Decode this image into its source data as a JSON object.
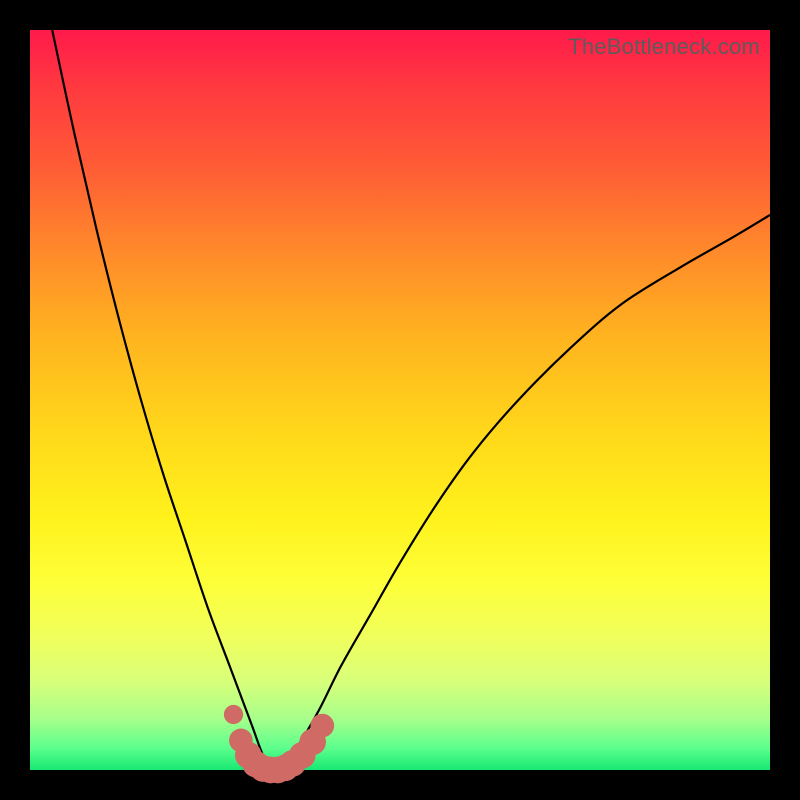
{
  "watermark": "TheBottleneck.com",
  "chart_data": {
    "type": "line",
    "title": "",
    "xlabel": "",
    "ylabel": "",
    "xlim": [
      0,
      100
    ],
    "ylim": [
      0,
      100
    ],
    "grid": false,
    "legend": false,
    "note": "Values estimated from pixel positions; curve dips to ~0 near x≈33.",
    "series": [
      {
        "name": "left-branch",
        "x": [
          3,
          6,
          9,
          12,
          15,
          18,
          21,
          24,
          27,
          30,
          31.5,
          33
        ],
        "y": [
          100,
          86,
          73,
          61,
          50,
          40,
          31,
          22,
          14,
          6,
          2,
          0
        ]
      },
      {
        "name": "right-branch",
        "x": [
          33,
          36,
          39,
          42,
          46,
          50,
          55,
          60,
          66,
          73,
          80,
          88,
          95,
          100
        ],
        "y": [
          0,
          3,
          8,
          14,
          21,
          28,
          36,
          43,
          50,
          57,
          63,
          68,
          72,
          75
        ]
      }
    ],
    "markers": {
      "color": "#cf6a64",
      "points": [
        {
          "x": 27.5,
          "y": 7.5,
          "r": 1.3
        },
        {
          "x": 28.5,
          "y": 4.0,
          "r": 1.6
        },
        {
          "x": 29.5,
          "y": 2.0,
          "r": 1.8
        },
        {
          "x": 30.5,
          "y": 0.8,
          "r": 1.8
        },
        {
          "x": 31.5,
          "y": 0.2,
          "r": 1.8
        },
        {
          "x": 32.5,
          "y": 0.0,
          "r": 1.8
        },
        {
          "x": 33.5,
          "y": 0.0,
          "r": 1.8
        },
        {
          "x": 34.5,
          "y": 0.3,
          "r": 1.8
        },
        {
          "x": 35.5,
          "y": 0.9,
          "r": 1.8
        },
        {
          "x": 36.8,
          "y": 2.0,
          "r": 1.8
        },
        {
          "x": 38.2,
          "y": 3.8,
          "r": 1.8
        },
        {
          "x": 39.5,
          "y": 6.0,
          "r": 1.6
        }
      ]
    },
    "background_gradient": {
      "top": "#ff1a4b",
      "mid": "#fff21c",
      "bottom": "#17e873"
    }
  }
}
